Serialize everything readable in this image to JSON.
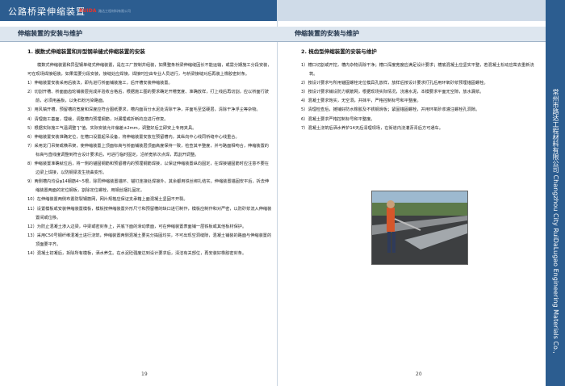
{
  "header": {
    "title": "公路桥梁伸缩装置",
    "logo_text": "RUIDA",
    "logo_sub": "路达工程材料有限公司"
  },
  "side_strip": "常州市路达工程材料有限公司 Changzhou City RuiDaLugao Engineering Materials Co., Ltd.",
  "section_title": "伸缩装置的安装与维护",
  "left_page": {
    "subtitle": "1. 模数式伸缩装置和异型钢单缝式伸缩装置的安装",
    "intro": "模数式伸缩装置和异型钢单缝式伸缩装置，是在工厂按制并组装，如果整条桥梁伸缩缝因长不能运输，或需分期施工分段安装，可在现场焊接组装，如果需要分段安装，接缝处应焊接，焊接时应由专业人员进行，与桥梁接缝对后再装上橡胶密封条。",
    "items": [
      "1）伸缩装置安装采用后装法，即先进行桥面铺装施工，后开槽安装伸缩装置。",
      "2）切割开槽、桥面面齿轮铺装层完成并验收合格后，根据施工图的要求确定开槽宽度、准确放样，打上线后再切割，应以桥面行驶前，必须用盖板，以免石粉污染路面。",
      "3）用风镐开槽，预留槽的宽度和深度应符合图纸要求，槽内面百分水泥处清除干净，并面毛至坚硬层，清除干净浮尘等杂物。",
      "4）清理施工基面，埋栽，调整槽内预埋钢筋，对漏埋或折断的应进行修复。",
      "5）根据实际施工气温调整“J”值，实际安装允许偏差±2mm，调整好后立即安上专用夹具。",
      "6）伸缩装置安装准确定位，在槽口设置起吊设备，将伸缩装置安放在预留槽内，其纵向中心线同桥缝中心线重合。",
      "7）采用龙门吊架或横吊架，使伸缩装置上顶面标高与桥面铺装层顶面高度保持一致，检查其平整度，并与路面相吻合，伸缩装置的标高与直线度调整到符合设计要求后，可进行临时固定，沿桥宽依次点焊，再割开调整。",
      "8）伸缩装置准确就位后，将一侧的锚固钢筋和预留槽内的预埋钢筋焊接，以保证伸缩装置纵向固定，在焊接锚固筋时应注意不要在边梁上焊接，以防钢梁发生挠曲变形。",
      "9）两侧槽内均设φ14钢筋4~5根，除同伸缩装置锚环、锚钉连接处焊接外，其余都用铁丝绑扎结实。伸缩装置锚固安平后，拆去伸缩装置两面的定位钢板，割除定位螺栓，用钢丝捆扎固定。",
      "10）在伸缩装置两侧布置防裂钢筋网，网片规格应保证支承箱上面混凝土坚固不开裂。",
      "11）设置模板或安装伸缩装置模板，模板按伸缩装置外形尺寸和预留槽的缺口进行制作，模板应制作和对严密，以防砂浆流入伸缩装置间或位移。",
      "12）为防止混凝土渗入边梁，中梁或密封条上，并底下面的滑动表面，可在伸缩装置表面铺一层铁板或其他板材保护。",
      "13）采用C50号钢纤维混凝土进行浇筑，伸缩装置两侧混凝土要充分捣固均实，不可出现空洞缝隙，混凝土铺装的路面与伸缩装置的顶面要平齐。",
      "14）混凝土初凝后，拆除所有模板，洒水养生。在水泥砼强度达到设计要求后，清洁有关部位，再安装好橡胶密封条。"
    ],
    "page_number": "19"
  },
  "right_page": {
    "subtitle": "2. 梳齿型伸缩装置的安装与维护",
    "items": [
      "1）槽口切割或开挖，槽内杂物清除干净；槽口深度宽度应满足设计要求；槽底混凝土应坚实平整，若混凝土松动应凿去重新浇筑。",
      "2）按设计要求与所用锚固螺栓定位模具孔放样，放样后按设计要求打孔后用环氧砂浆预埋锚固螺栓。",
      "3）按设计要求铺设防力钢筋网，根据现场实际情况，浇灌水泥，本模要求平面无空隙，放水漏浆。",
      "4）混凝土要求饱实，无空洞，并抹平，严格控制标号和平整度。",
      "5）清理检查后，摊铺好防水橡胶及不锈钢滑板；紧固锚固螺栓，并用环氧砂浆灌注螺栓孔洞隙。",
      "6）混凝土要求严格控制标号和平整度。",
      "7）混凝土浇筑后洒水养护14天后清理现场，在街道内浇灌沥青后方可通车。"
    ],
    "page_number": "20"
  },
  "colors": {
    "brand_blue": "#2c5d90",
    "section_bg": "#dde6ef"
  }
}
